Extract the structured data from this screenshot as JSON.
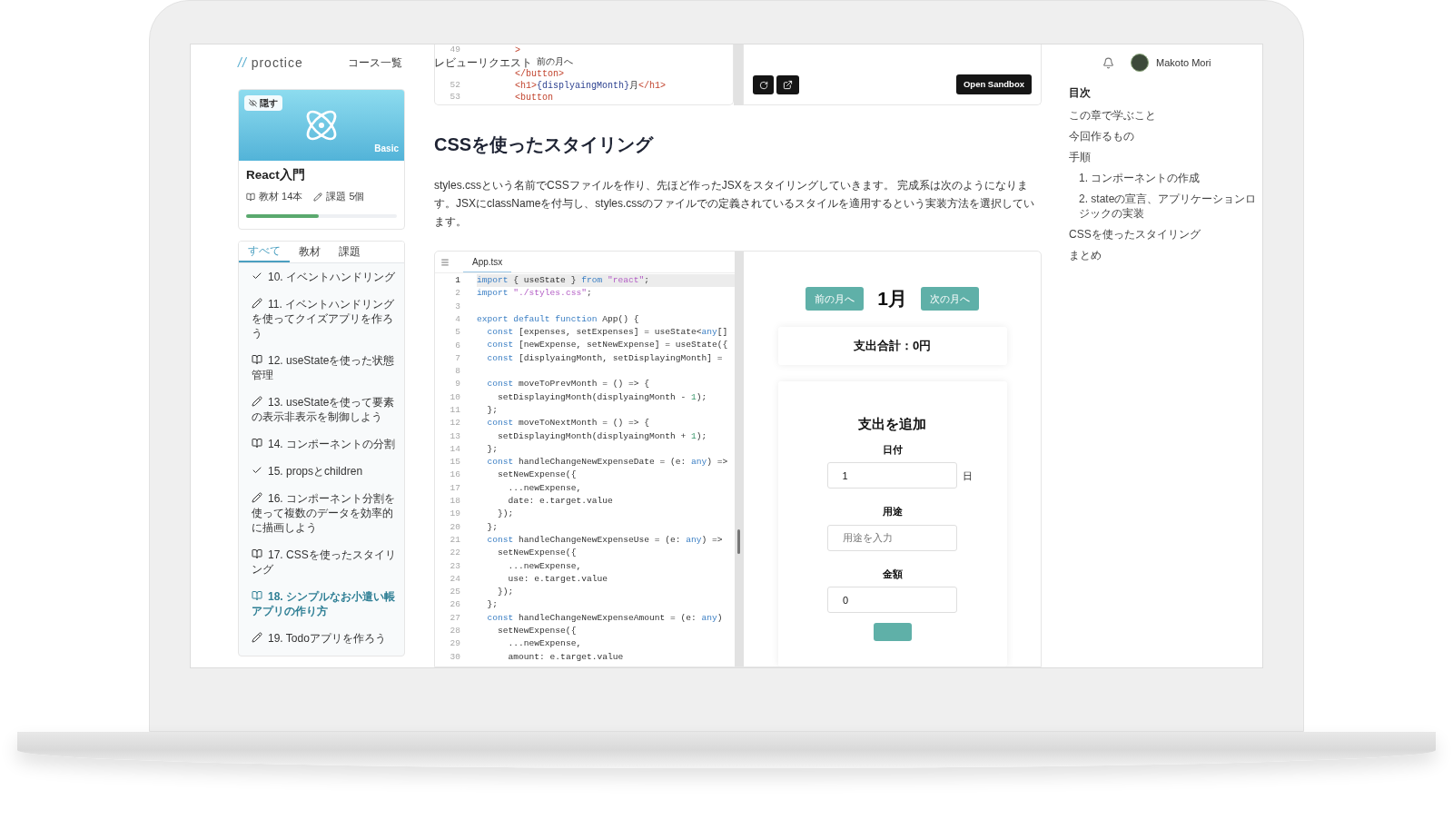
{
  "header": {
    "logo": {
      "mark": "//",
      "word": "proctice"
    },
    "nav": [
      {
        "label": "コース一覧"
      },
      {
        "label": "レビューリクエスト"
      }
    ],
    "user": {
      "name": "Makoto Mori"
    }
  },
  "course": {
    "badge": "隠す",
    "level": "Basic",
    "title": "React入門",
    "materials": {
      "label": "教材",
      "count": "14本"
    },
    "tasks": {
      "label": "課題",
      "count": "5個"
    },
    "progress": {
      "level": 0.48
    }
  },
  "tabs": [
    {
      "label": "すべて",
      "selected": true
    },
    {
      "label": "教材",
      "selected": false
    },
    {
      "label": "課題",
      "selected": false
    }
  ],
  "chapters": [
    {
      "kind": "completed",
      "title": "10. イベントハンドリング",
      "selected": false
    },
    {
      "kind": "exercise",
      "title": "11. イベントハンドリングを使ってクイズアプリを作ろう",
      "selected": false
    },
    {
      "kind": "lesson",
      "title": "12. useStateを使った状態管理",
      "selected": false
    },
    {
      "kind": "exercise",
      "title": "13. useStateを使って要素の表示非表示を制御しよう",
      "selected": false
    },
    {
      "kind": "lesson",
      "title": "14. コンポーネントの分割",
      "selected": false
    },
    {
      "kind": "completed",
      "title": "15. propsとchildren",
      "selected": false
    },
    {
      "kind": "exercise",
      "title": "16. コンポーネント分割を使って複数のデータを効率的に描画しよう",
      "selected": false
    },
    {
      "kind": "lesson",
      "title": "17. CSSを使ったスタイリング",
      "selected": false
    },
    {
      "kind": "lesson",
      "title": "18. シンプルなお小遣い帳アプリの作り方",
      "selected": true
    },
    {
      "kind": "exercise",
      "title": "19. Todoアプリを作ろう",
      "selected": false
    }
  ],
  "snippet": {
    "lines": [
      {
        "no": "49",
        "parts": [
          {
            "kind": "tag",
            "text": "        >"
          }
        ]
      },
      {
        "parts": [
          {
            "kind": "plain",
            "text": "            前の月へ"
          }
        ]
      },
      {
        "parts": [
          {
            "kind": "tag",
            "text": "        </button>"
          }
        ]
      },
      {
        "no": "52",
        "parts": [
          {
            "kind": "tag",
            "text": "        <h1>"
          },
          {
            "kind": "name",
            "text": "{displyaingMonth}"
          },
          {
            "kind": "plain",
            "text": "月"
          },
          {
            "kind": "tag",
            "text": "</h1>"
          }
        ]
      },
      {
        "no": "53",
        "parts": [
          {
            "kind": "tag",
            "text": "        <button"
          }
        ]
      }
    ]
  },
  "preview_toolbar": {
    "open_button": "Open Sandbox"
  },
  "article": {
    "heading": "CSSを使ったスタイリング",
    "paragraph": "styles.cssという名前でCSSファイルを作り、先ほど作ったJSXをスタイリングしていきます。 完成系は次のようになります。JSXにclassNameを付与し、styles.cssのファイルでの定義されているスタイルを適用するという実装方法を選択しています。"
  },
  "editor": {
    "file": "App.tsx",
    "lines": [
      {
        "no": "1",
        "active": true,
        "parts": [
          {
            "kind": "keyword",
            "text": "import"
          },
          {
            "kind": "plain",
            "text": " { useState } "
          },
          {
            "kind": "keyword",
            "text": "from"
          },
          {
            "kind": "string",
            "text": " \"react\""
          },
          {
            "kind": "plain",
            "text": ";"
          }
        ]
      },
      {
        "no": "2",
        "active": false,
        "parts": [
          {
            "kind": "keyword",
            "text": "import"
          },
          {
            "kind": "string",
            "text": " \"./styles.css\""
          },
          {
            "kind": "plain",
            "text": ";"
          }
        ]
      },
      {
        "no": "3",
        "active": false
      },
      {
        "no": "4",
        "active": false,
        "parts": [
          {
            "kind": "keyword",
            "text": "export default function"
          },
          {
            "kind": "plain",
            "text": " App() {"
          }
        ]
      },
      {
        "no": "5",
        "active": false,
        "parts": [
          {
            "kind": "keyword",
            "text": "  const"
          },
          {
            "kind": "plain",
            "text": " [expenses, setExpenses] = useState<"
          },
          {
            "kind": "keyword",
            "text": "any"
          },
          {
            "kind": "plain",
            "text": "[]"
          }
        ]
      },
      {
        "no": "6",
        "active": false,
        "parts": [
          {
            "kind": "keyword",
            "text": "  const"
          },
          {
            "kind": "plain",
            "text": " [newExpense, setNewExpense] = useState({"
          }
        ]
      },
      {
        "no": "7",
        "active": false,
        "parts": [
          {
            "kind": "keyword",
            "text": "  const"
          },
          {
            "kind": "plain",
            "text": " [displyaingMonth, setDisplayingMonth] ="
          }
        ]
      },
      {
        "no": "8",
        "active": false
      },
      {
        "no": "9",
        "active": false,
        "parts": [
          {
            "kind": "keyword",
            "text": "  const"
          },
          {
            "kind": "plain",
            "text": " moveToPrevMonth = () => {"
          }
        ]
      },
      {
        "no": "10",
        "active": false,
        "parts": [
          {
            "kind": "plain",
            "text": "    setDisplayingMonth(displyaingMonth - "
          },
          {
            "kind": "number",
            "text": "1"
          },
          {
            "kind": "plain",
            "text": ");"
          }
        ]
      },
      {
        "no": "11",
        "active": false,
        "parts": [
          {
            "kind": "plain",
            "text": "  };"
          }
        ]
      },
      {
        "no": "12",
        "active": false,
        "parts": [
          {
            "kind": "keyword",
            "text": "  const"
          },
          {
            "kind": "plain",
            "text": " moveToNextMonth = () => {"
          }
        ]
      },
      {
        "no": "13",
        "active": false,
        "parts": [
          {
            "kind": "plain",
            "text": "    setDisplayingMonth(displyaingMonth + "
          },
          {
            "kind": "number",
            "text": "1"
          },
          {
            "kind": "plain",
            "text": ");"
          }
        ]
      },
      {
        "no": "14",
        "active": false,
        "parts": [
          {
            "kind": "plain",
            "text": "  };"
          }
        ]
      },
      {
        "no": "15",
        "active": false,
        "parts": [
          {
            "kind": "keyword",
            "text": "  const"
          },
          {
            "kind": "plain",
            "text": " handleChangeNewExpenseDate = (e: "
          },
          {
            "kind": "keyword",
            "text": "any"
          },
          {
            "kind": "plain",
            "text": ") =>"
          }
        ]
      },
      {
        "no": "16",
        "active": false,
        "parts": [
          {
            "kind": "plain",
            "text": "    setNewExpense({"
          }
        ]
      },
      {
        "no": "17",
        "active": false,
        "parts": [
          {
            "kind": "plain",
            "text": "      ...newExpense,"
          }
        ]
      },
      {
        "no": "18",
        "active": false,
        "parts": [
          {
            "kind": "plain",
            "text": "      date: e.target.value"
          }
        ]
      },
      {
        "no": "19",
        "active": false,
        "parts": [
          {
            "kind": "plain",
            "text": "    });"
          }
        ]
      },
      {
        "no": "20",
        "active": false,
        "parts": [
          {
            "kind": "plain",
            "text": "  };"
          }
        ]
      },
      {
        "no": "21",
        "active": false,
        "parts": [
          {
            "kind": "keyword",
            "text": "  const"
          },
          {
            "kind": "plain",
            "text": " handleChangeNewExpenseUse = (e: "
          },
          {
            "kind": "keyword",
            "text": "any"
          },
          {
            "kind": "plain",
            "text": ") =>"
          }
        ]
      },
      {
        "no": "22",
        "active": false,
        "parts": [
          {
            "kind": "plain",
            "text": "    setNewExpense({"
          }
        ]
      },
      {
        "no": "23",
        "active": false,
        "parts": [
          {
            "kind": "plain",
            "text": "      ...newExpense,"
          }
        ]
      },
      {
        "no": "24",
        "active": false,
        "parts": [
          {
            "kind": "plain",
            "text": "      use: e.target.value"
          }
        ]
      },
      {
        "no": "25",
        "active": false,
        "parts": [
          {
            "kind": "plain",
            "text": "    });"
          }
        ]
      },
      {
        "no": "26",
        "active": false,
        "parts": [
          {
            "kind": "plain",
            "text": "  };"
          }
        ]
      },
      {
        "no": "27",
        "active": false,
        "parts": [
          {
            "kind": "keyword",
            "text": "  const"
          },
          {
            "kind": "plain",
            "text": " handleChangeNewExpenseAmount = (e: "
          },
          {
            "kind": "keyword",
            "text": "any"
          },
          {
            "kind": "plain",
            "text": ")"
          }
        ]
      },
      {
        "no": "28",
        "active": false,
        "parts": [
          {
            "kind": "plain",
            "text": "    setNewExpense({"
          }
        ]
      },
      {
        "no": "29",
        "active": false,
        "parts": [
          {
            "kind": "plain",
            "text": "      ...newExpense,"
          }
        ]
      },
      {
        "no": "30",
        "active": false,
        "parts": [
          {
            "kind": "plain",
            "text": "      amount: e.target.value"
          }
        ]
      }
    ]
  },
  "app_preview": {
    "prev_button": "前の月へ",
    "month": "1月",
    "next_button": "次の月へ",
    "total": "支出合計：0円",
    "form": {
      "title": "支出を追加",
      "fields": [
        {
          "label": "日付",
          "value": "1",
          "suffix": "日"
        },
        {
          "label": "用途",
          "placeholder": "用途を入力"
        },
        {
          "label": "金額",
          "value": "0"
        }
      ]
    }
  },
  "toc": {
    "title": "目次",
    "items": [
      {
        "label": "この章で学ぶこと"
      },
      {
        "label": "今回作るもの"
      },
      {
        "label": "手順",
        "children": [
          {
            "label": "1. コンポーネントの作成"
          },
          {
            "label": "2. stateの宣言、アプリケーションロジックの実装"
          }
        ]
      },
      {
        "label": "CSSを使ったスタイリング"
      },
      {
        "label": "まとめ"
      }
    ]
  }
}
